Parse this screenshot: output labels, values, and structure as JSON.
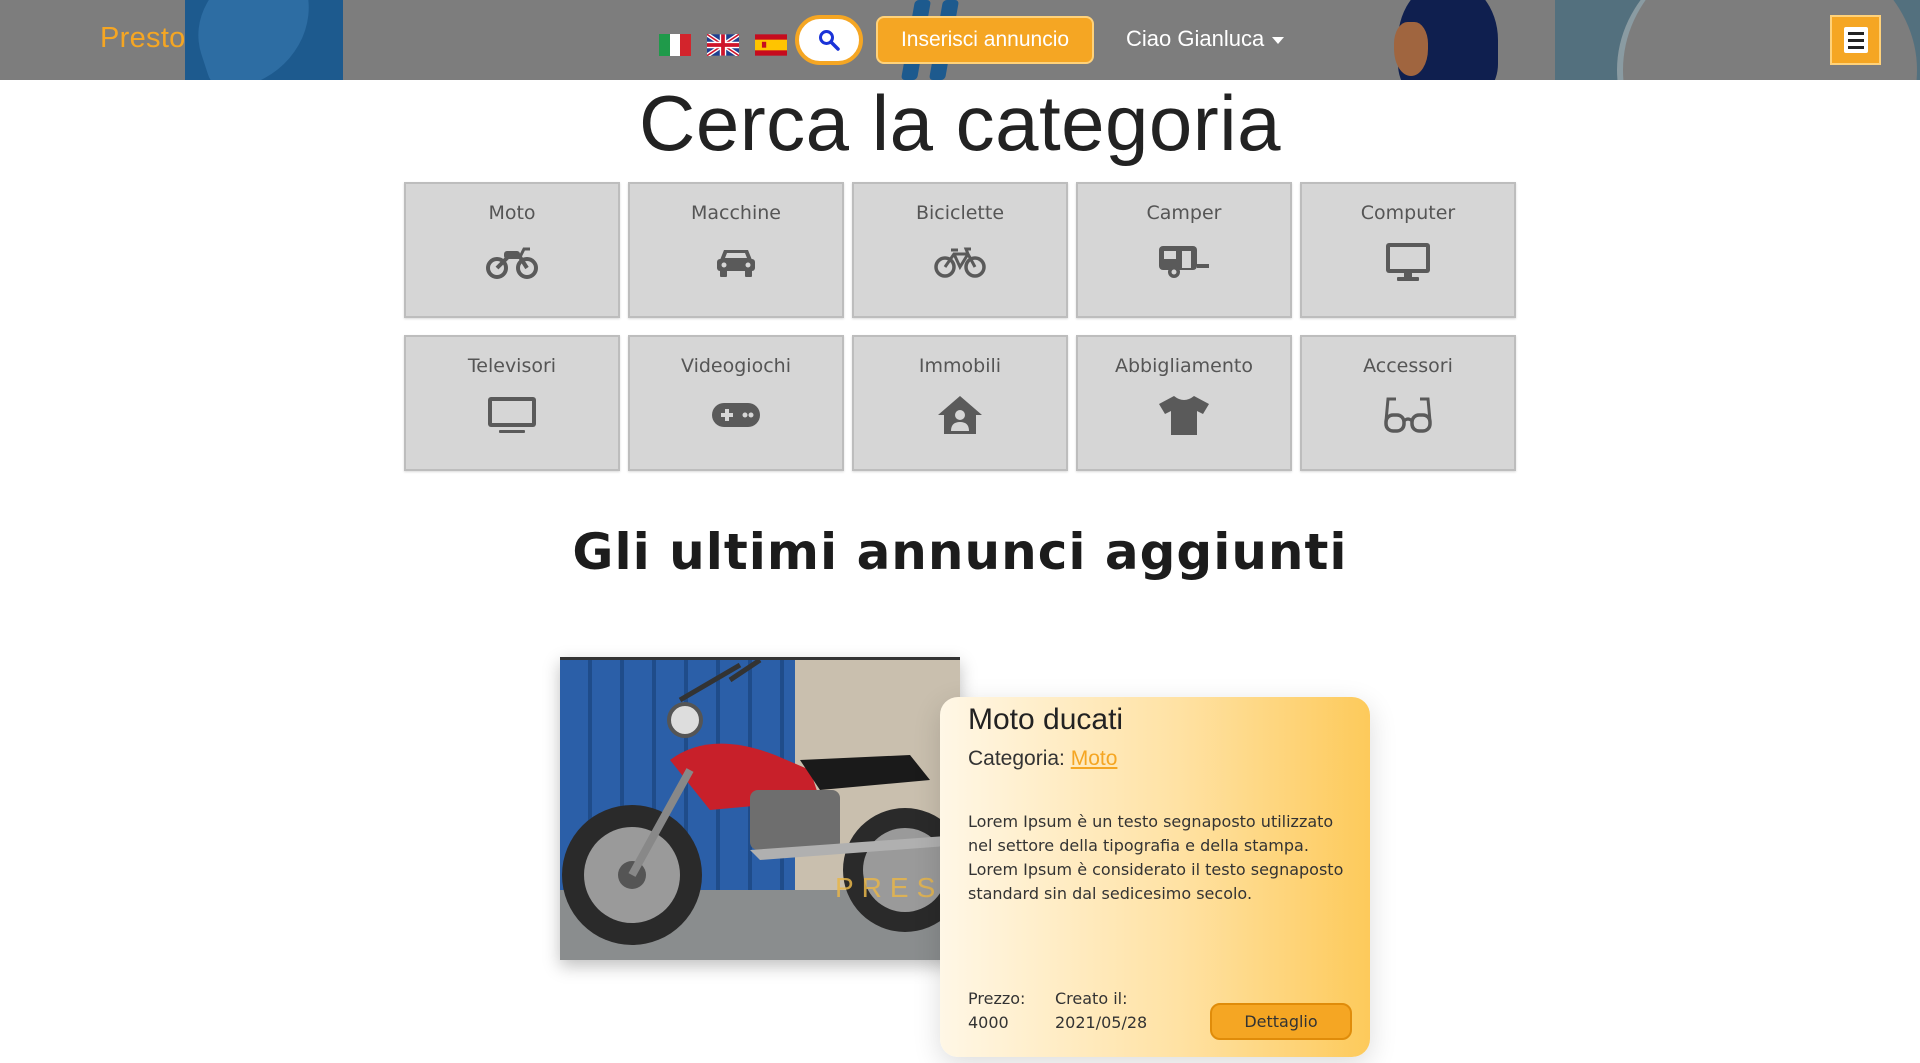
{
  "navbar": {
    "brand": "Presto",
    "flags": [
      {
        "name": "flag-italy",
        "lang": "it"
      },
      {
        "name": "flag-uk",
        "lang": "en"
      },
      {
        "name": "flag-spain",
        "lang": "es"
      }
    ],
    "search_icon": "search-icon",
    "insert_label": "Inserisci annuncio",
    "user_greeting": "Ciao Gianluca",
    "menu_icon": "hamburger-icon",
    "accent_color": "#f5a623",
    "bar_color": "#7d7d7d"
  },
  "categories": {
    "title": "Cerca la categoria",
    "items": [
      {
        "label": "Moto",
        "icon": "motorcycle-icon"
      },
      {
        "label": "Macchine",
        "icon": "car-icon"
      },
      {
        "label": "Biciclette",
        "icon": "bicycle-icon"
      },
      {
        "label": "Camper",
        "icon": "caravan-icon"
      },
      {
        "label": "Computer",
        "icon": "desktop-icon"
      },
      {
        "label": "Televisori",
        "icon": "tv-icon"
      },
      {
        "label": "Videogiochi",
        "icon": "gamepad-icon"
      },
      {
        "label": "Immobili",
        "icon": "house-user-icon"
      },
      {
        "label": "Abbigliamento",
        "icon": "tshirt-icon"
      },
      {
        "label": "Accessori",
        "icon": "glasses-icon"
      }
    ]
  },
  "latest": {
    "title": "Gli ultimi annunci aggiunti",
    "ads": [
      {
        "title": "Moto ducati",
        "category_label": "Categoria:",
        "category": "Moto",
        "description": "Lorem Ipsum è un testo segnaposto utilizzato nel settore della tipografia e della stampa. Lorem Ipsum è considerato il testo segnaposto standard sin dal sedicesimo secolo.",
        "price_label": "Prezzo:",
        "price": "4000",
        "created_label": "Creato il:",
        "created": "2021/05/28",
        "detail_label": "Dettaglio",
        "watermark": "PRESTO"
      }
    ]
  }
}
